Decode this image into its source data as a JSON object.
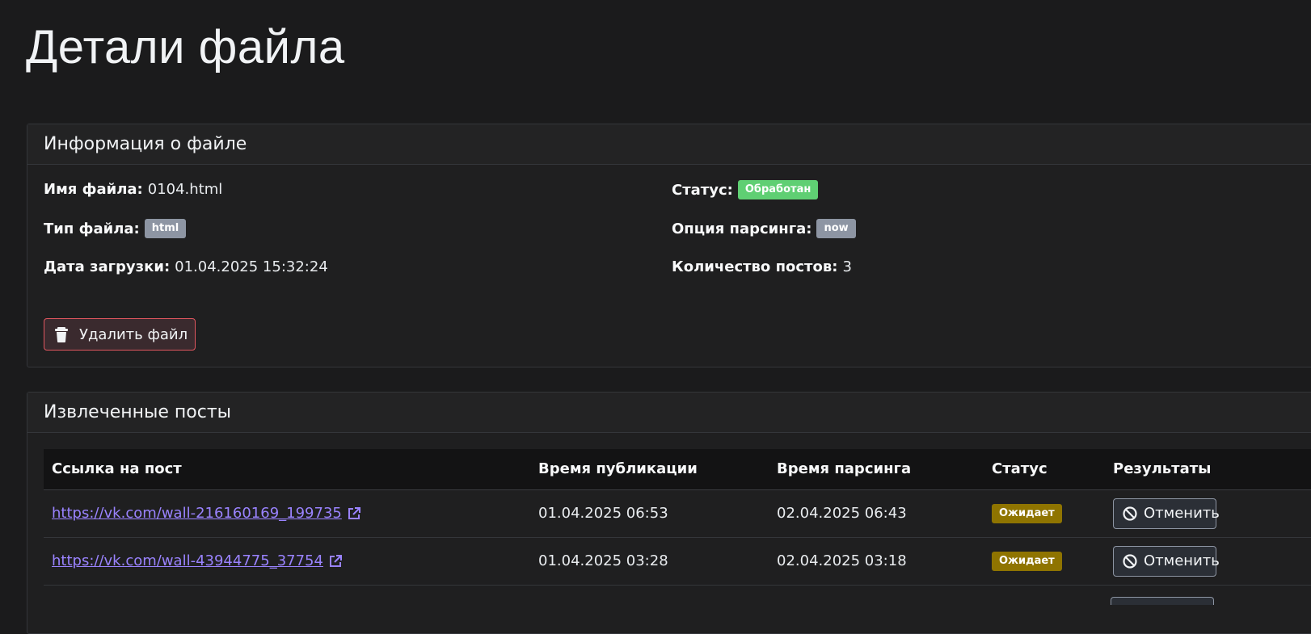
{
  "page": {
    "title": "Детали файла"
  },
  "file_info": {
    "header": "Информация о файле",
    "name_label": "Имя файла:",
    "name_value": "0104.html",
    "type_label": "Тип файла:",
    "type_value": "html",
    "upload_label": "Дата загрузки:",
    "upload_value": "01.04.2025 15:32:24",
    "status_label": "Статус:",
    "status_value": "Обработан",
    "parse_option_label": "Опция парсинга:",
    "parse_option_value": "now",
    "post_count_label": "Количество постов:",
    "post_count_value": "3",
    "delete_button": "Удалить файл"
  },
  "posts": {
    "header": "Извлеченные посты",
    "columns": [
      "Ссылка на пост",
      "Время публикации",
      "Время парсинга",
      "Статус",
      "Результаты"
    ],
    "rows": [
      {
        "link": "https://vk.com/wall-216160169_199735",
        "published": "01.04.2025 06:53",
        "parse_time": "02.04.2025 06:43",
        "status": "Ожидает",
        "action": "Отменить"
      },
      {
        "link": "https://vk.com/wall-43944775_37754",
        "published": "01.04.2025 03:28",
        "parse_time": "02.04.2025 03:18",
        "status": "Ожидает",
        "action": "Отменить"
      }
    ]
  },
  "colors": {
    "background": "#1b1b1c",
    "success": "#5fcf73",
    "warning": "#8f7400",
    "danger": "#e0565f",
    "link": "#9a83ff"
  },
  "icons": {
    "delete": "trash-icon",
    "external": "external-link-icon",
    "cancel": "ban-icon"
  }
}
